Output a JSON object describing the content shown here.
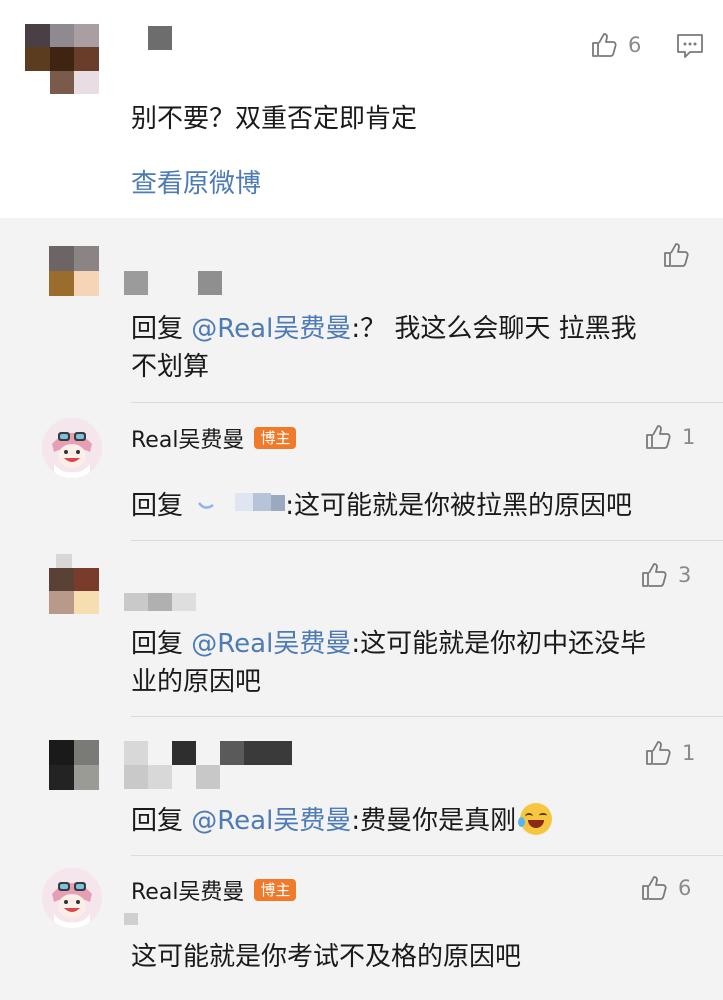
{
  "top_comment": {
    "text": "别不要？双重否定即肯定",
    "likes": "6",
    "view_original_link": "查看原微博"
  },
  "replies": [
    {
      "prefix": "回复 ",
      "mention": "@Real吴费曼",
      "body": ":？ 我这么会聊天 拉黑我",
      "body2": "不划算",
      "likes": ""
    },
    {
      "username": "Real吴费曼",
      "badge": "博主",
      "prefix": "回复 ",
      "body": ":这可能就是你被拉黑的原因吧",
      "likes": "1"
    },
    {
      "prefix": "回复 ",
      "mention": "@Real吴费曼",
      "body": ":这可能就是你初中还没毕",
      "body2": "业的原因吧",
      "likes": "3"
    },
    {
      "prefix": "回复 ",
      "mention": "@Real吴费曼",
      "body": ":费曼你是真刚",
      "likes": "1"
    },
    {
      "username": "Real吴费曼",
      "badge": "博主",
      "body": "这可能就是你考试不及格的原因吧",
      "likes": "6"
    }
  ],
  "icons": {
    "like": "thumbs-up-icon",
    "comment": "comment-icon",
    "emoji": "laugh-cry-emoji-icon"
  },
  "colors": {
    "mention": "#4d7bb5",
    "badge": "#f07a2a",
    "reply_bg": "#f3f3f3"
  }
}
